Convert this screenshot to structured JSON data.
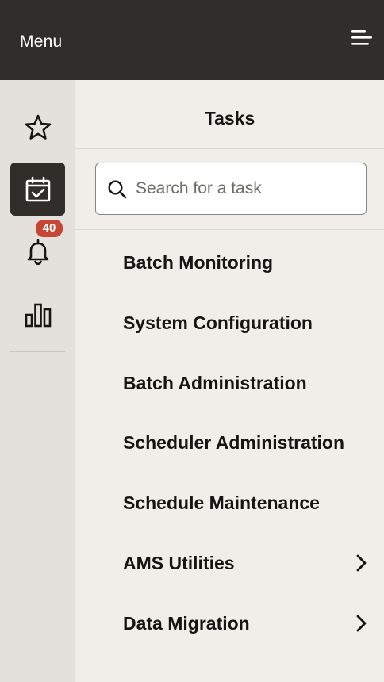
{
  "header": {
    "title": "Menu",
    "menu_icon": "hamburger-menu-icon"
  },
  "rail": {
    "items": [
      {
        "icon": "star-icon",
        "name": "favorites",
        "active": false
      },
      {
        "icon": "calendar-check-icon",
        "name": "tasks",
        "active": true
      },
      {
        "icon": "bell-icon",
        "name": "notifications",
        "active": false,
        "badge": "40"
      },
      {
        "icon": "bar-chart-icon",
        "name": "reports",
        "active": false
      }
    ]
  },
  "panel": {
    "title": "Tasks",
    "search": {
      "placeholder": "Search for a task",
      "value": ""
    },
    "tasks": [
      {
        "label": "Batch Monitoring",
        "has_submenu": false
      },
      {
        "label": "System Configuration",
        "has_submenu": false
      },
      {
        "label": "Batch Administration",
        "has_submenu": false
      },
      {
        "label": "Scheduler Administration",
        "has_submenu": false
      },
      {
        "label": "Schedule Maintenance",
        "has_submenu": false
      },
      {
        "label": "AMS Utilities",
        "has_submenu": true
      },
      {
        "label": "Data Migration",
        "has_submenu": true
      }
    ]
  },
  "colors": {
    "header_bg": "#312d2a",
    "rail_bg": "#e4e1dc",
    "panel_bg": "#f1eeea",
    "badge_bg": "#c74634",
    "text": "#161513"
  }
}
